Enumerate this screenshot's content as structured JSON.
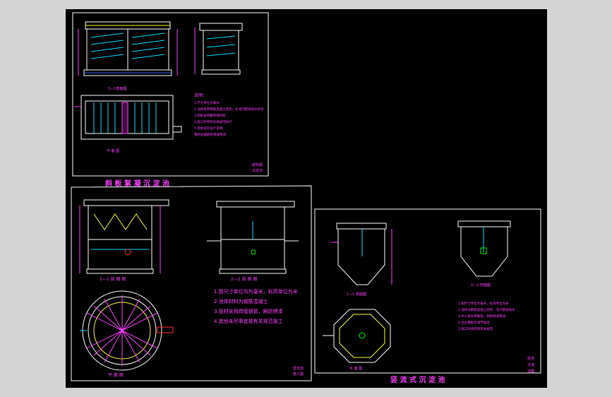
{
  "colors": {
    "background": "#000000",
    "outer": "#d4d4d4",
    "line": "#ffffff",
    "text": "#ff40ff",
    "accent_cyan": "#00e0ff",
    "accent_green": "#00ff00",
    "accent_yellow": "#ffff40",
    "accent_red": "#ff3030"
  },
  "sheet1": {
    "title": "斜 板 絮 凝 沉 淀 池",
    "section_label": "1—1剖面图",
    "plan_label": "平 面 图",
    "notes_title": "说明：",
    "notes": [
      "1.尺寸单位为毫米",
      "2.池体采用钢筋混凝土结构，水池内壁抹防水砂浆",
      "3.斜板采用聚丙烯材料",
      "4.施工时参照有关规范执行",
      "5.其他详见设计说明",
      "钢材表面刷防锈漆两道"
    ],
    "stamp": [
      "结构图",
      "沉淀池"
    ]
  },
  "sheet2": {
    "section1_label": "1—1 剖 面 图",
    "section2_label": "2—2 剖 面 图",
    "plan_label": "平 面 图",
    "notes": [
      "1.图尺寸单位均为毫米，标高单位为米",
      "2.池体材料为钢筋混凝土",
      "3.管材采用焊接钢管，刷防锈漆",
      "4.其他未尽事宜按有关规范施工"
    ],
    "stamp": [
      "竖流池",
      "施工图"
    ]
  },
  "sheet3": {
    "title": "竖 流 式 沉 淀 池",
    "section1_label": "1—1 剖面图",
    "section2_label": "2—2 剖面图",
    "plan_label": "平 面 图",
    "notes": [
      "1.图尺寸单位为毫米，标高单位为米",
      "2.池体为钢筋混凝土结构，池内壁抹防水",
      "3.中心管采用钢管，刷防锈漆两道",
      "4.出水堰板可调节高度",
      "5.施工时请参照有关规范"
    ],
    "stamp": [
      "竖流",
      "沉淀",
      "池图"
    ]
  }
}
